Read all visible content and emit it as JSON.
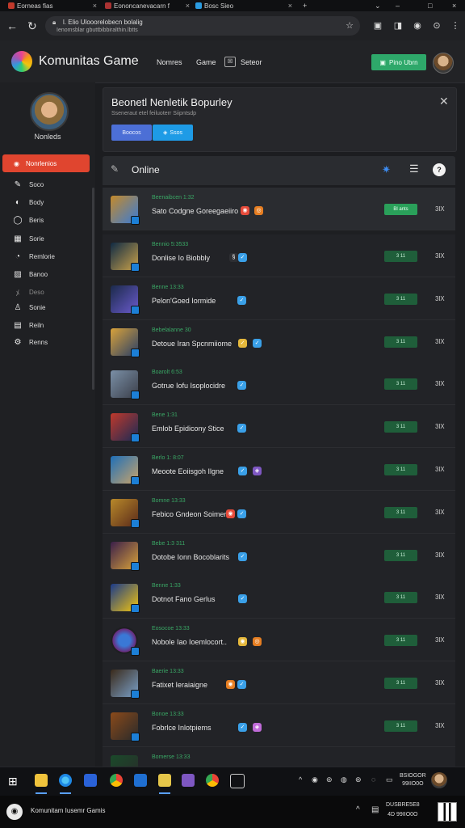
{
  "browser": {
    "tabs": [
      {
        "label": "Eorneas fias"
      },
      {
        "label": "Eononcanevacarn f"
      },
      {
        "label": "Bosc Sieo"
      }
    ],
    "url_line1": "l. Elio Ulooorelobecn bolalig",
    "url_line2": "Ienomsblar gbuttbibbiralthin.lbtts"
  },
  "app": {
    "title": "Komunitas Game",
    "nav": [
      "Nomres",
      "Game",
      "Seteor"
    ],
    "header_button": "Pino Ubrn"
  },
  "sidebar": {
    "username": "Nonleds",
    "active_item": "Nonrlenios",
    "items": [
      "Soco",
      "Body",
      "Beris",
      "Sorie",
      "Remlorie",
      "Banoo",
      "Deso",
      "Sonie",
      "Reiln",
      "Renns"
    ]
  },
  "panel": {
    "title": "Beonetl Nenletik Bopurley",
    "subtitle": "Sseneraut etel feiluoterr Siipntsdp",
    "button1": "Boocos",
    "button2": "Ssos"
  },
  "online": {
    "title": "Online",
    "rows": [
      {
        "label": "Beenaibcen 1:32",
        "title": "Sato Codgne Goreegaeiiro",
        "status": "Bl ants",
        "more": "3lX"
      },
      {
        "label": "Bennio 5:3533",
        "title": "Donlise Io Biobbly",
        "status": "3 11",
        "more": "3lX"
      },
      {
        "label": "Benne 13:33",
        "title": "Pelon'Goed Iormide",
        "status": "3 11",
        "more": "3lX"
      },
      {
        "label": "Bebelalanne 30",
        "title": "Detoue Iran Spcnmiiome",
        "status": "3 11",
        "more": "3lX"
      },
      {
        "label": "Boarolt 6:53",
        "title": "Gotrue Iofu Isoplocidre",
        "status": "3 11",
        "more": "3lX"
      },
      {
        "label": "Bene 1:31",
        "title": "Emlob Epidicony Stice",
        "status": "3 11",
        "more": "3lX"
      },
      {
        "label": "Berlo 1: 8:07",
        "title": "Meoote Eoiisgoh Ilgne",
        "status": "3 11",
        "more": "3lX"
      },
      {
        "label": "Bomne 13:33",
        "title": "Febico Gndeon Soimer",
        "status": "3 11",
        "more": "3lX"
      },
      {
        "label": "Bebe 1:3 311",
        "title": "Dotobe Ionn Bocoblarits",
        "status": "3 11",
        "more": "3lX"
      },
      {
        "label": "Benne 1:33",
        "title": "Dotnot Fano Gerlus",
        "status": "3 11",
        "more": "3lX"
      },
      {
        "label": "Eosocoe 13:33",
        "title": "Nobole Iao Ioemlocort..",
        "status": "3 11",
        "more": "3lX"
      },
      {
        "label": "Baerie 13:33",
        "title": "Fatixet Ieraiaigne",
        "status": "3 11",
        "more": "3lX"
      },
      {
        "label": "Bonoe 13:33",
        "title": "Fobrlce Inlotpiems",
        "status": "3 11",
        "more": "3lX"
      },
      {
        "label": "Bomerse 13:33",
        "title": "",
        "status": "",
        "more": ""
      }
    ]
  },
  "taskbar": {
    "clock_line1": "BSIOGOR",
    "clock_line2": "99IIO0O"
  },
  "bottombar": {
    "text": "Komunitam Iusemr Gamis",
    "clock_line1": "DUSBRE5E8",
    "clock_line2": "4D 99IIO0O"
  }
}
